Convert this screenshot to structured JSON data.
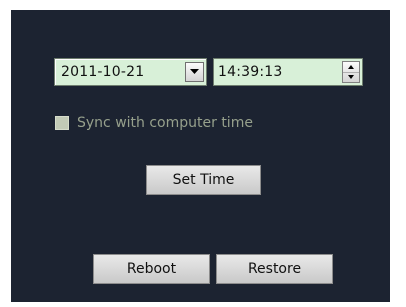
{
  "date_picker": {
    "value": "2011-10-21",
    "icon": "chevron-down-icon"
  },
  "time_field": {
    "value": "14:39:13",
    "up_icon": "spin-up-icon",
    "down_icon": "spin-down-icon"
  },
  "sync": {
    "label": "Sync with computer time",
    "checked": false
  },
  "buttons": {
    "set_time": "Set Time",
    "reboot": "Reboot",
    "restore": "Restore"
  },
  "colors": {
    "panel_bg": "#1c2331",
    "field_bg": "#d8f0d8",
    "disabled_text": "#96a08c"
  }
}
